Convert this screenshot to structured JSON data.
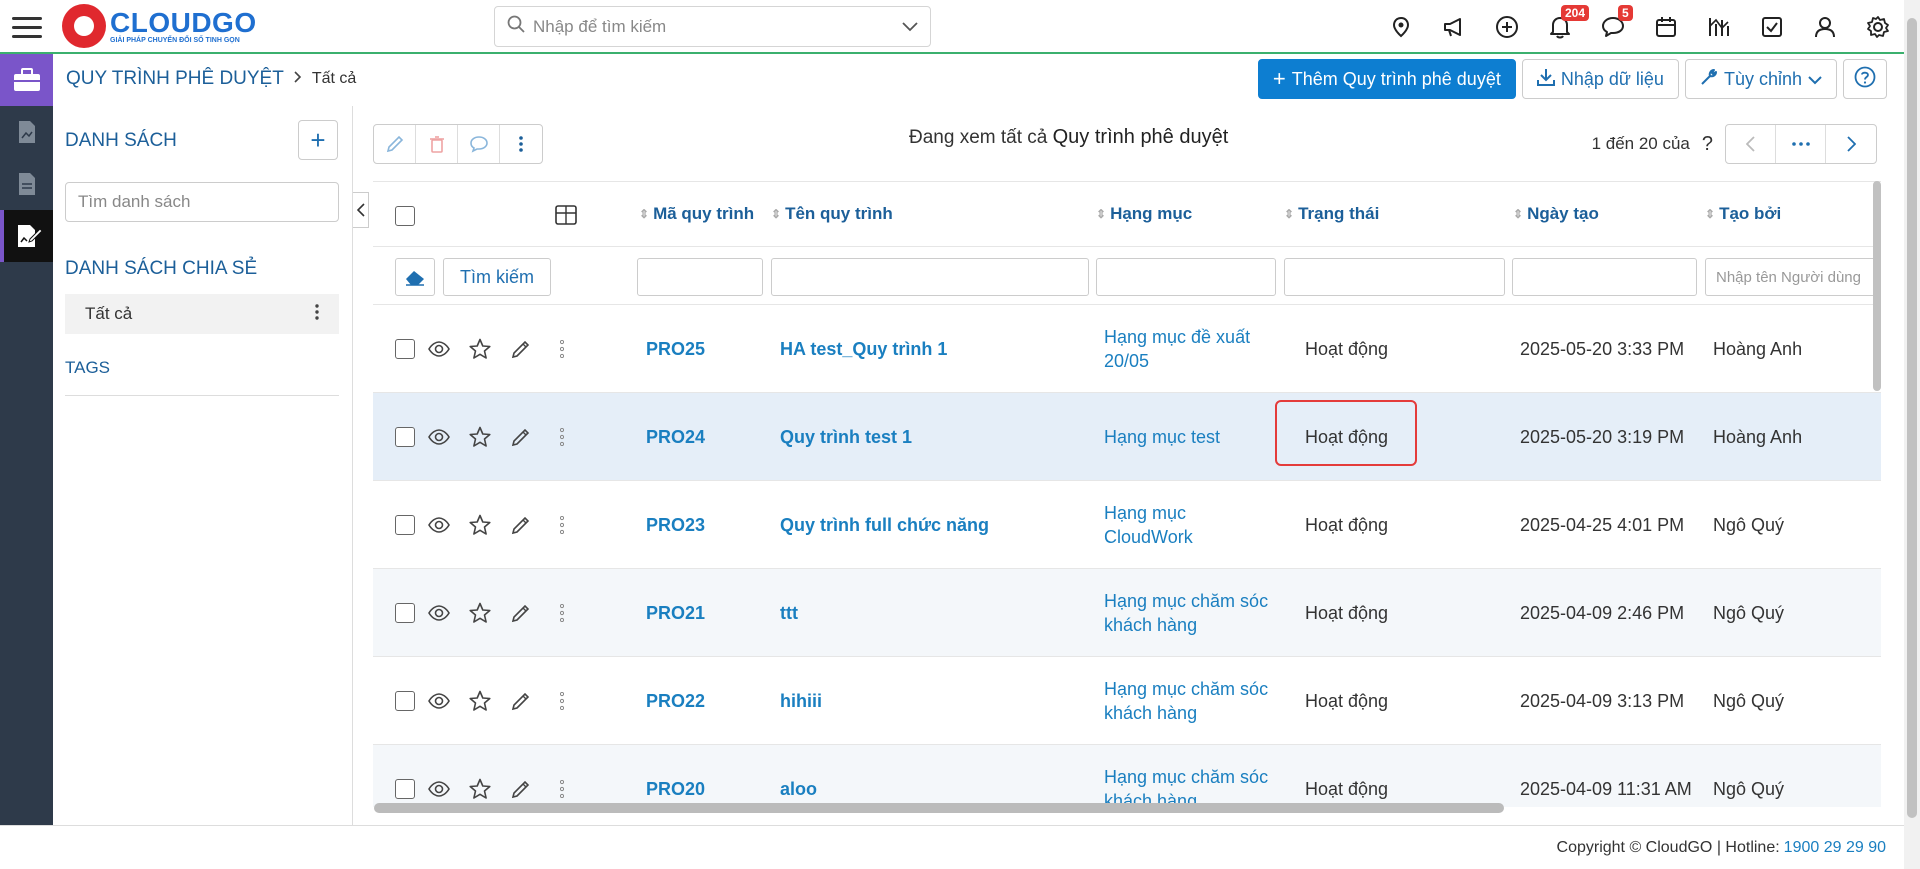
{
  "app": {
    "logo_name": "CLOUDGO",
    "logo_tagline": "GIẢI PHÁP CHUYỂN ĐỔI SỐ TINH GỌN"
  },
  "search": {
    "placeholder": "Nhập để tìm kiếm"
  },
  "top_icons": [
    {
      "icon": "location-pin-icon"
    },
    {
      "icon": "megaphone-icon"
    },
    {
      "icon": "plus-circle-icon"
    },
    {
      "icon": "bell-icon",
      "badge": "204"
    },
    {
      "icon": "chat-icon",
      "badge": "5"
    },
    {
      "icon": "calendar-icon"
    },
    {
      "icon": "chart-icon"
    },
    {
      "icon": "checkbox-icon"
    },
    {
      "icon": "user-icon"
    },
    {
      "icon": "gear-icon"
    }
  ],
  "breadcrumb": {
    "title": "QUY TRÌNH PHÊ DUYỆT",
    "current": "Tất cả"
  },
  "actions": {
    "add_label": "Thêm Quy trình phê duyệt",
    "import_label": "Nhập dữ liệu",
    "customize_label": "Tùy chỉnh"
  },
  "sidebar": {
    "list_header": "DANH SÁCH",
    "search_placeholder": "Tìm danh sách",
    "shared_header": "DANH SÁCH CHIA SẺ",
    "shared_item": "Tất cả",
    "tags_header": "TAGS"
  },
  "viewing": {
    "prefix": "Đang xem tất cả",
    "module": "Quy trình phê duyệt"
  },
  "pager": {
    "text": "1 đến 20 của",
    "unknown": "?"
  },
  "table": {
    "columns": {
      "code": "Mã quy trình",
      "name": "Tên quy trình",
      "category": "Hạng mục",
      "status": "Trạng thái",
      "created": "Ngày tạo",
      "creator": "Tạo bởi"
    },
    "search_button": "Tìm kiếm",
    "creator_filter_placeholder": "Nhập tên Người dùng",
    "rows": [
      {
        "code": "PRO25",
        "name": "HA test_Quy trình 1",
        "category": "Hạng mục đề xuất 20/05",
        "status": "Hoạt động",
        "created": "2025-05-20 3:33 PM",
        "creator": "Hoàng Anh"
      },
      {
        "code": "PRO24",
        "name": "Quy trình test 1",
        "category": "Hạng mục test",
        "status": "Hoạt động",
        "created": "2025-05-20 3:19 PM",
        "creator": "Hoàng Anh"
      },
      {
        "code": "PRO23",
        "name": "Quy trình full chức năng",
        "category": "Hạng mục CloudWork",
        "status": "Hoạt động",
        "created": "2025-04-25 4:01 PM",
        "creator": "Ngô Quý"
      },
      {
        "code": "PRO21",
        "name": "ttt",
        "category": "Hạng mục chăm sóc khách hàng",
        "status": "Hoạt động",
        "created": "2025-04-09 2:46 PM",
        "creator": "Ngô Quý"
      },
      {
        "code": "PRO22",
        "name": "hihiii",
        "category": "Hạng mục chăm sóc khách hàng",
        "status": "Hoạt động",
        "created": "2025-04-09 3:13 PM",
        "creator": "Ngô Quý"
      },
      {
        "code": "PRO20",
        "name": "aloo",
        "category": "Hạng mục chăm sóc khách hàng",
        "status": "Hoạt động",
        "created": "2025-04-09 11:31 AM",
        "creator": "Ngô Quý"
      }
    ]
  },
  "footer": {
    "copyright": "Copyright © CloudGO | Hotline:",
    "hotline": "1900 29 29 90"
  },
  "colors": {
    "brand": "#1f6fd0",
    "primary_button": "#0d7ed1",
    "link": "#1a7fc0",
    "rail": "#2e3a4a",
    "rail_active": "#7a55c9",
    "highlight": "#e43b3b"
  }
}
